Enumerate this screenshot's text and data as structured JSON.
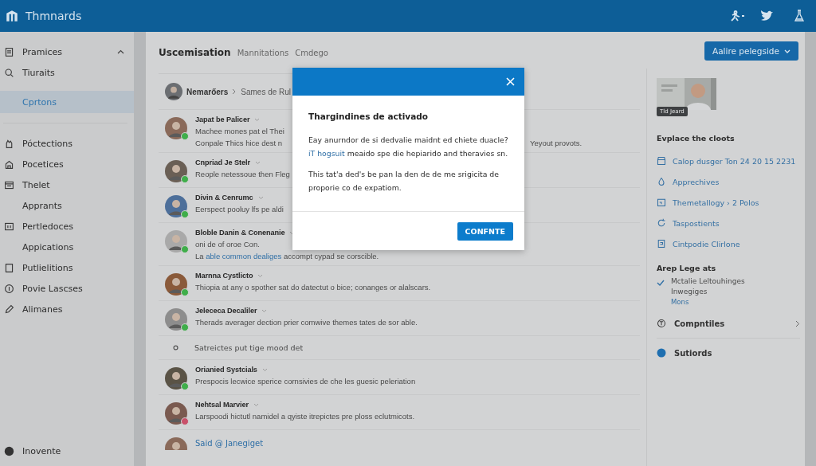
{
  "app_bar": {
    "title": "Thmnards"
  },
  "sidebar": {
    "section": {
      "label": "Pramices",
      "expanded": true
    },
    "items": [
      {
        "label": "Tiuraits",
        "selected": false
      },
      {
        "label": "Cprtons",
        "selected": true
      },
      {
        "label": "Póctections",
        "selected": false
      },
      {
        "label": "Pocetices",
        "selected": false
      },
      {
        "label": "Thelet",
        "selected": false
      },
      {
        "label": "Apprants",
        "selected": false
      },
      {
        "label": "Pertledoces",
        "selected": false
      },
      {
        "label": "Appications",
        "selected": false
      },
      {
        "label": "Putlielitions",
        "selected": false
      },
      {
        "label": "Povie Lascses",
        "selected": false
      },
      {
        "label": "Alimanes",
        "selected": false
      }
    ],
    "footer": "Inovente"
  },
  "main": {
    "tabs": [
      {
        "label": "Uscemisation",
        "selected": true
      },
      {
        "label": "Mannitations",
        "selected": false
      },
      {
        "label": "Cmdego",
        "selected": false
      }
    ],
    "breadcrumb": [
      "Nemarőers",
      "Sames de Rul"
    ],
    "feed": [
      {
        "kind": "post",
        "name": "Japat be Palicer",
        "color": "#3fae4a",
        "lines": [
          {
            "text": "Machee mones pat el Thei"
          },
          {
            "text": "Conpale Thics hice dest n",
            "trailing": "Yeyout provots."
          }
        ]
      },
      {
        "kind": "post",
        "name": "Cnpriad Je Stelr",
        "color": "#3fae4a",
        "lines": [
          {
            "text": "Reople netessoue then Fleg"
          }
        ]
      },
      {
        "kind": "post",
        "name": "Divin & Cenrumc",
        "color": "#3fae4a",
        "lines": [
          {
            "text": "Eerspect pooluy lfs pe aldi"
          }
        ]
      },
      {
        "kind": "post",
        "name": "Bloble Danin & Conenanie",
        "color": "#3fae4a",
        "lines": [
          {
            "text": "oni de of oroe Con."
          },
          {
            "text": "La",
            "link": "able common dealiges",
            "after": "accompt cypad se corscible."
          }
        ]
      },
      {
        "kind": "post",
        "name": "Marnna Cystlicto",
        "color": "#3fae4a",
        "lines": [
          {
            "text": "Thiopia at any o spother sat do datectut o bice; conanges or alalscars."
          }
        ]
      },
      {
        "kind": "post",
        "name": "Jelececa Decaliler",
        "color": "#3fae4a",
        "lines": [
          {
            "text": "Therads averager dection prier comwive themes tates de sor able."
          }
        ]
      },
      {
        "kind": "note",
        "text": "Satreictes put tige mood det"
      },
      {
        "kind": "post",
        "name": "Orianied Systcials",
        "color": "#3fae4a",
        "lines": [
          {
            "text": "Prespocis lecwice sperice cornsivies de che les guesic peleriation"
          }
        ]
      },
      {
        "kind": "post",
        "name": "Nehtsal Marvier",
        "color": "#c9506a",
        "lines": [
          {
            "text": "Larspoodi hictutl namidel a qyiste itrepictes pre ploss eclutmicots."
          }
        ]
      },
      {
        "kind": "mention",
        "text": "Said @ Janegiget"
      }
    ]
  },
  "right_panel": {
    "action_button": "Aalire pelegside",
    "picture": {
      "kind": "picture",
      "caption": "Tld Jeard"
    },
    "heading": "Evplace the cloots",
    "links": [
      "Calop dusger Ton 24 20 15 2231",
      "Apprechives",
      "Themetallogy › 2 Polos",
      "Taspostients",
      "Cintpodie Clirlone"
    ],
    "section_title": "Arep Lege ats",
    "checklist": {
      "checked": true,
      "lines": [
        "Mctalie Leltouhinges",
        "Inwegiges"
      ],
      "more": "Mons"
    },
    "rows": [
      {
        "label": "Compntiles"
      },
      {
        "label": "Sutiords"
      }
    ]
  },
  "dialog": {
    "heading": "Thargindines de activado",
    "paragraph_1": {
      "first": "Eay anurndor de si dedvalie maidnt ed chiete duacle?",
      "link": "iT hogsuit",
      "rest": "meaido spe die hepiarido and theravies sn."
    },
    "paragraph_2": "This tat'a ded's be pan la den de de me srigicita de proporie co de expatiom.",
    "button": "CONFNTE"
  }
}
